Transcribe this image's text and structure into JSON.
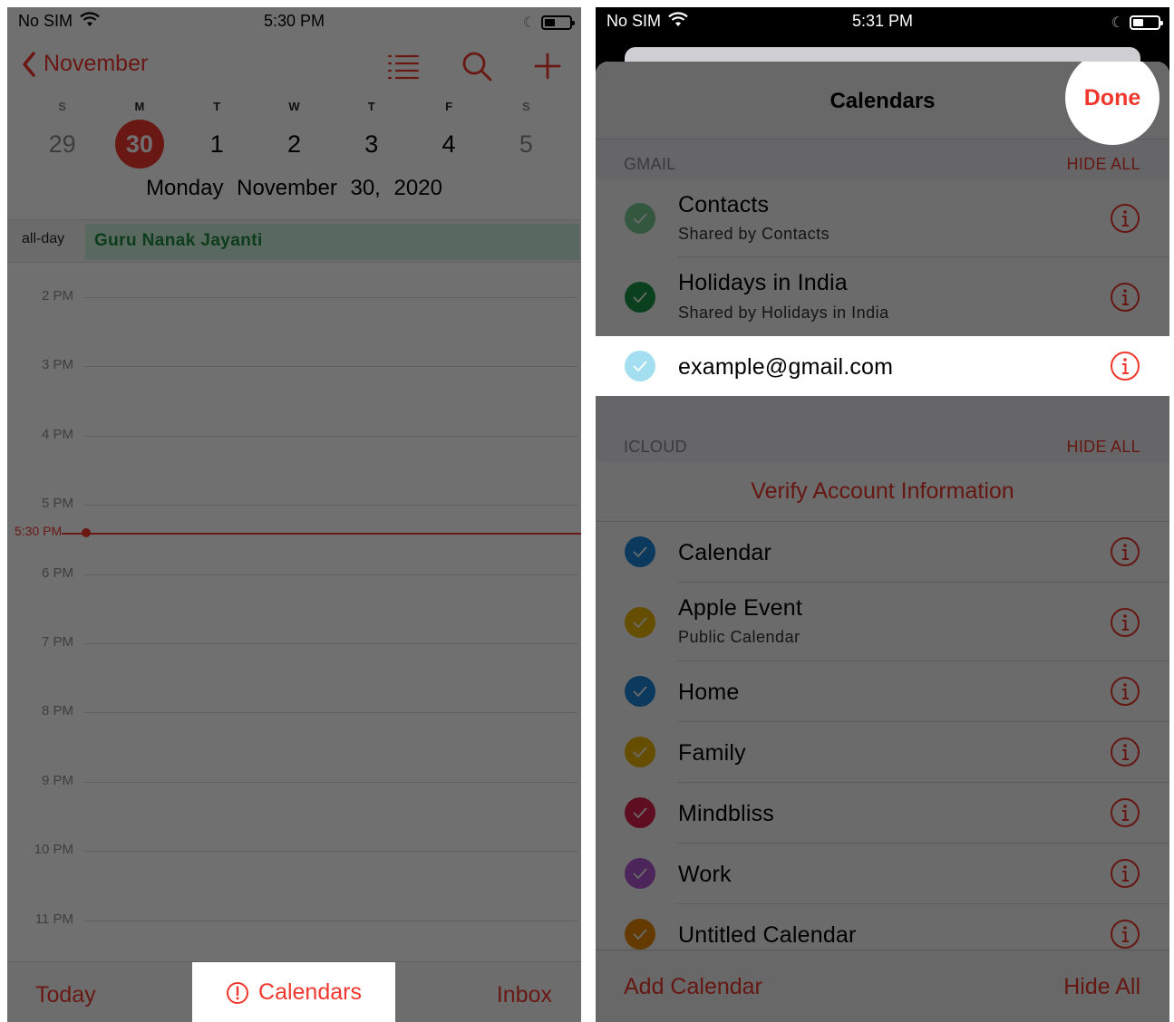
{
  "colors": {
    "accent": "#f0372d",
    "allday_bg": "#cdeed8",
    "allday_text": "#1e8a43"
  },
  "left": {
    "status": {
      "carrier": "No SIM",
      "time": "5:30 PM"
    },
    "nav": {
      "back_label": "November",
      "icons": [
        "list-icon",
        "search-icon",
        "plus-icon"
      ]
    },
    "week": [
      {
        "dow": "S",
        "num": "29"
      },
      {
        "dow": "M",
        "num": "30"
      },
      {
        "dow": "T",
        "num": "1"
      },
      {
        "dow": "W",
        "num": "2"
      },
      {
        "dow": "T",
        "num": "3"
      },
      {
        "dow": "F",
        "num": "4"
      },
      {
        "dow": "S",
        "num": "5"
      }
    ],
    "full_date": "Monday November 30, 2020",
    "allday_label": "all-day",
    "allday_event": "Guru Nanak Jayanti",
    "hours": [
      "2 PM",
      "3 PM",
      "4 PM",
      "5 PM",
      "6 PM",
      "7 PM",
      "8 PM",
      "9 PM",
      "10 PM",
      "11 PM"
    ],
    "now_label": "5:30 PM",
    "toolbar": {
      "today": "Today",
      "calendars": "Calendars",
      "inbox": "Inbox"
    }
  },
  "right": {
    "status": {
      "carrier": "No SIM",
      "time": "5:31 PM"
    },
    "title": "Calendars",
    "done": "Done",
    "gmail": {
      "section": "GMAIL",
      "hide_all": "HIDE ALL",
      "items": [
        {
          "title": "Contacts",
          "subtitle": "Shared by Contacts",
          "color": "#7ccf9a"
        },
        {
          "title": "Holidays in India",
          "subtitle": "Shared by Holidays in India",
          "color": "#1a9a45"
        },
        {
          "title": "example@gmail.com",
          "subtitle": "",
          "color": "#a3dff0"
        }
      ]
    },
    "icloud": {
      "section": "ICLOUD",
      "hide_all": "HIDE ALL",
      "verify": "Verify Account Information",
      "items": [
        {
          "title": "Calendar",
          "subtitle": "",
          "color": "#1b8be0"
        },
        {
          "title": "Apple Event",
          "subtitle": "Public Calendar",
          "color": "#f0b900"
        },
        {
          "title": "Home",
          "subtitle": "",
          "color": "#1b8be0"
        },
        {
          "title": "Family",
          "subtitle": "",
          "color": "#f0b900"
        },
        {
          "title": "Mindbliss",
          "subtitle": "",
          "color": "#e3214f"
        },
        {
          "title": "Work",
          "subtitle": "",
          "color": "#b65bd8"
        },
        {
          "title": "Untitled Calendar",
          "subtitle": "",
          "color": "#f08a00"
        }
      ]
    },
    "footer": {
      "add": "Add Calendar",
      "hide_all": "Hide All"
    }
  }
}
